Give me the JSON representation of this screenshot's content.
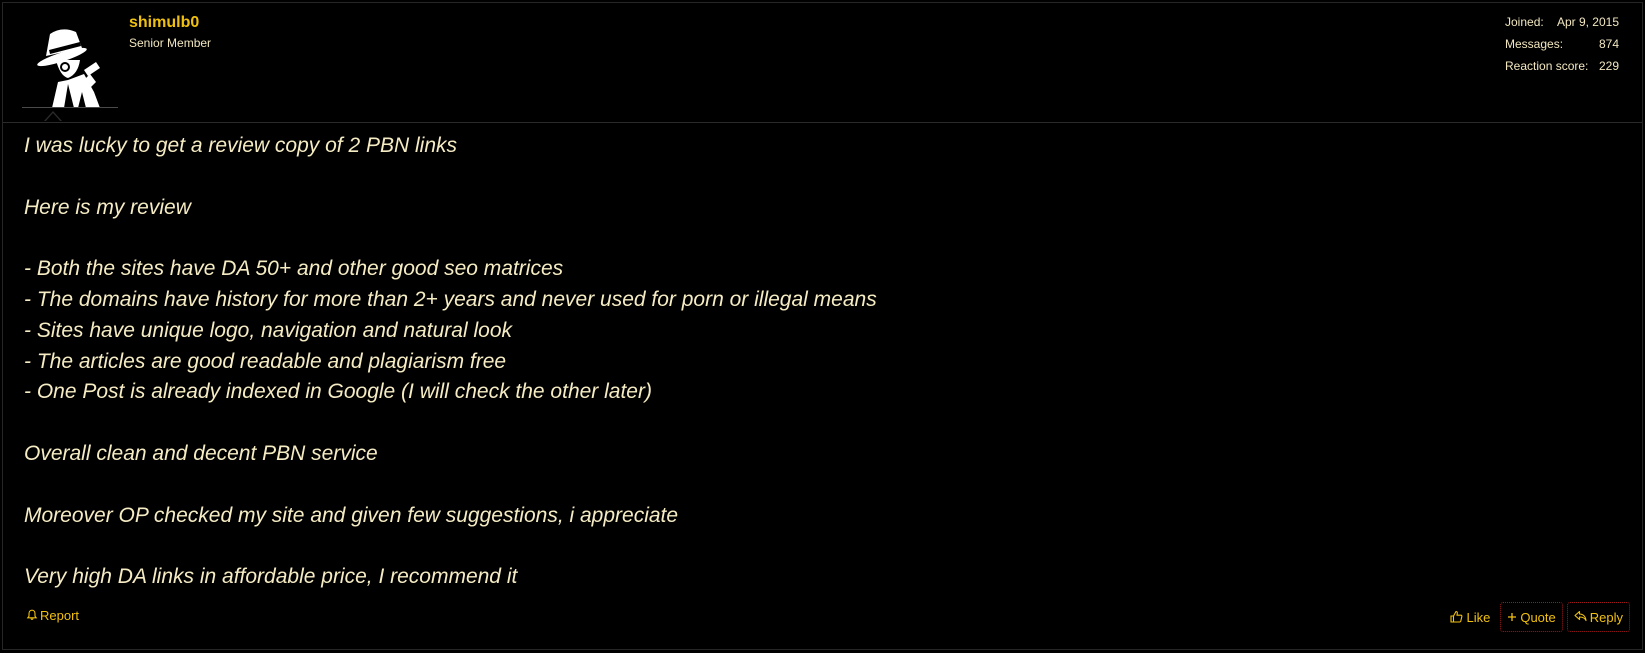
{
  "user": {
    "name": "shimulb0",
    "title": "Senior Member"
  },
  "stats": [
    {
      "label": "Joined:",
      "value": "Apr 9, 2015"
    },
    {
      "label": "Messages:",
      "value": "874"
    },
    {
      "label": "Reaction score:",
      "value": "229"
    }
  ],
  "post": {
    "lines": [
      "I was lucky to get a review copy of 2 PBN links",
      "",
      "Here is my review",
      "",
      "- Both the sites have DA 50+ and other good seo matrices",
      "- The domains have history for more than 2+ years and never used for porn or illegal means",
      "- Sites have unique logo, navigation and natural look",
      "- The articles are good readable and plagiarism free",
      "- One Post is already indexed in Google (I will check the other later)",
      "",
      "Overall clean and decent PBN service",
      "",
      "Moreover OP checked my site and given few suggestions, i appreciate",
      "",
      "Very high DA links in affordable price, I recommend it"
    ]
  },
  "footer": {
    "report_label": "Report",
    "like_label": "Like",
    "quote_label": "Quote",
    "reply_label": "Reply"
  },
  "colors": {
    "accent": "#f0c010",
    "text": "#f6ecc4",
    "background": "#000000",
    "button_border": "#a01818"
  },
  "icons": {
    "avatar": "hat-wearing-figure-avatar",
    "report": "bell-icon",
    "like": "thumbs-up-icon",
    "quote": "plus-icon",
    "reply": "reply-arrow-icon"
  }
}
